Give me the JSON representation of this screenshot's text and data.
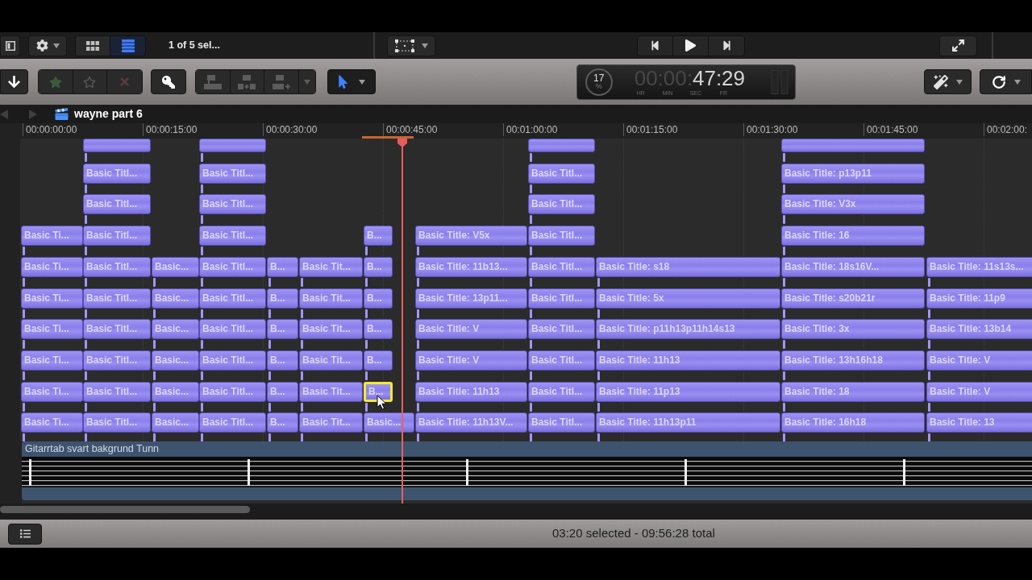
{
  "browser_bar": {
    "view_buttons": [
      {
        "selected": false
      },
      {
        "selected": true
      }
    ],
    "selection_info": "1 of 5 sel..."
  },
  "toolbar": {
    "rating_buttons": [
      {
        "disabled": true
      },
      {
        "disabled": true
      },
      {
        "disabled": true
      }
    ],
    "edit_buttons": [
      {
        "disabled": true
      },
      {
        "disabled": true
      },
      {
        "disabled": true
      },
      {
        "disabled": true
      }
    ],
    "dashboard": {
      "progress": "17",
      "progress_unit": "%",
      "timecode_dim": "00:00:",
      "timecode": "47:29",
      "units": [
        "HR",
        "MIN",
        "SEC",
        "FR"
      ]
    }
  },
  "timeline": {
    "nav_buttons": [
      {
        "disabled": true
      },
      {
        "disabled": true
      }
    ],
    "title": "wayne part 6",
    "ruler": [
      "00:00:00:00",
      "00:00:15:00",
      "00:00:30:00",
      "00:00:45:00",
      "00:01:00:00",
      "00:01:15:00",
      "00:01:30:00",
      "00:01:45:00",
      "00:02:00:"
    ],
    "lanes": [
      {
        "clips": [
          {
            "selected": false
          },
          {
            "selected": false
          },
          {
            "selected": false
          },
          {
            "selected": false
          }
        ]
      },
      {
        "clips": [
          {
            "label": "Basic Titl...",
            "selected": false
          },
          {
            "label": "Basic Titl...",
            "selected": false
          },
          {
            "label": "Basic Titl...",
            "selected": false
          },
          {
            "label": "Basic Title: p13p11",
            "selected": false
          }
        ]
      },
      {
        "clips": [
          {
            "label": "Basic Titl...",
            "selected": false
          },
          {
            "label": "Basic Titl...",
            "selected": false
          },
          {
            "label": "Basic Titl...",
            "selected": false
          },
          {
            "label": "Basic Title: V3x",
            "selected": false
          }
        ]
      },
      {
        "clips": [
          {
            "label": "Basic Ti...",
            "selected": false
          },
          {
            "label": "Basic Titl...",
            "selected": false
          },
          {
            "label": "Basic Titl...",
            "selected": false
          },
          {
            "label": "B...",
            "selected": false
          },
          {
            "label": "Basic Title: V5x",
            "selected": false
          },
          {
            "label": "Basic Titl...",
            "selected": false
          },
          {
            "label": "Basic Title: 16",
            "selected": false
          }
        ]
      },
      {
        "clips": [
          {
            "label": "Basic Ti...",
            "selected": false
          },
          {
            "label": "Basic Titl...",
            "selected": false
          },
          {
            "label": "Basic...",
            "selected": false
          },
          {
            "label": "Basic Titl...",
            "selected": false
          },
          {
            "label": "B...",
            "selected": false
          },
          {
            "label": "Basic Tit...",
            "selected": false
          },
          {
            "label": "B...",
            "selected": false
          },
          {
            "label": "Basic Title: 11b13...",
            "selected": false
          },
          {
            "label": "Basic Titl...",
            "selected": false
          },
          {
            "label": "Basic Title: s18",
            "selected": false
          },
          {
            "label": "Basic Title: 18s16V...",
            "selected": false
          },
          {
            "label": "Basic Title: 11s13s...",
            "selected": false
          }
        ]
      },
      {
        "clips": [
          {
            "label": "Basic Ti...",
            "selected": false
          },
          {
            "label": "Basic Titl...",
            "selected": false
          },
          {
            "label": "Basic...",
            "selected": false
          },
          {
            "label": "Basic Titl...",
            "selected": false
          },
          {
            "label": "B...",
            "selected": false
          },
          {
            "label": "Basic Tit...",
            "selected": false
          },
          {
            "label": "B...",
            "selected": false
          },
          {
            "label": "Basic Title: 13p11...",
            "selected": false
          },
          {
            "label": "Basic Titl...",
            "selected": false
          },
          {
            "label": "Basic Title: 5x",
            "selected": false
          },
          {
            "label": "Basic Title: s20b21r",
            "selected": false
          },
          {
            "label": "Basic Title: 11p9",
            "selected": false
          }
        ]
      },
      {
        "clips": [
          {
            "label": "Basic Ti...",
            "selected": false
          },
          {
            "label": "Basic Titl...",
            "selected": false
          },
          {
            "label": "Basic...",
            "selected": false
          },
          {
            "label": "Basic Titl...",
            "selected": false
          },
          {
            "label": "B...",
            "selected": false
          },
          {
            "label": "Basic Tit...",
            "selected": false
          },
          {
            "label": "B...",
            "selected": false
          },
          {
            "label": "Basic Title: V",
            "selected": false
          },
          {
            "label": "Basic Titl...",
            "selected": false
          },
          {
            "label": "Basic Title: p11h13p11h14s13",
            "selected": false
          },
          {
            "label": "Basic Title: 3x",
            "selected": false
          },
          {
            "label": "Basic Title: 13b14",
            "selected": false
          }
        ]
      },
      {
        "clips": [
          {
            "label": "Basic Ti...",
            "selected": false
          },
          {
            "label": "Basic Titl...",
            "selected": false
          },
          {
            "label": "Basic...",
            "selected": false
          },
          {
            "label": "Basic Titl...",
            "selected": false
          },
          {
            "label": "B...",
            "selected": false
          },
          {
            "label": "Basic Tit...",
            "selected": false
          },
          {
            "label": "B...",
            "selected": false
          },
          {
            "label": "Basic Title: V",
            "selected": false
          },
          {
            "label": "Basic Titl...",
            "selected": false
          },
          {
            "label": "Basic Title: 11h13",
            "selected": false
          },
          {
            "label": "Basic Title: 13h16h18",
            "selected": false
          },
          {
            "label": "Basic Title: V",
            "selected": false
          }
        ]
      },
      {
        "clips": [
          {
            "label": "Basic Ti...",
            "selected": false
          },
          {
            "label": "Basic Titl...",
            "selected": false
          },
          {
            "label": "Basic...",
            "selected": false
          },
          {
            "label": "Basic Titl...",
            "selected": false
          },
          {
            "label": "B...",
            "selected": false
          },
          {
            "label": "Basic Tit...",
            "selected": false
          },
          {
            "label": "B...",
            "selected": true
          },
          {
            "label": "Basic Title: 11h13",
            "selected": false
          },
          {
            "label": "Basic Titl...",
            "selected": false
          },
          {
            "label": "Basic Title: 11p13",
            "selected": false
          },
          {
            "label": "Basic Title: 18",
            "selected": false
          },
          {
            "label": "Basic Title: V",
            "selected": false
          }
        ]
      },
      {
        "clips": [
          {
            "label": "Basic Ti...",
            "selected": false
          },
          {
            "label": "Basic Titl...",
            "selected": false
          },
          {
            "label": "Basic...",
            "selected": false
          },
          {
            "label": "Basic Titl...",
            "selected": false
          },
          {
            "label": "B...",
            "selected": false
          },
          {
            "label": "Basic Tit...",
            "selected": false
          },
          {
            "label": "Basic...",
            "selected": false
          },
          {
            "label": "Basic Title: 11h13V...",
            "selected": false
          },
          {
            "label": "Basic Titl...",
            "selected": false
          },
          {
            "label": "Basic Title: 11h13p11",
            "selected": false
          },
          {
            "label": "Basic Title: 16h18",
            "selected": false
          },
          {
            "label": "Basic Title: 13",
            "selected": false
          }
        ]
      }
    ],
    "storyline_clip": {
      "label": "Gitarrtab svart bakgrund Tunn"
    }
  },
  "status_bar": {
    "summary": "03:20 selected - 09:56:28 total"
  }
}
